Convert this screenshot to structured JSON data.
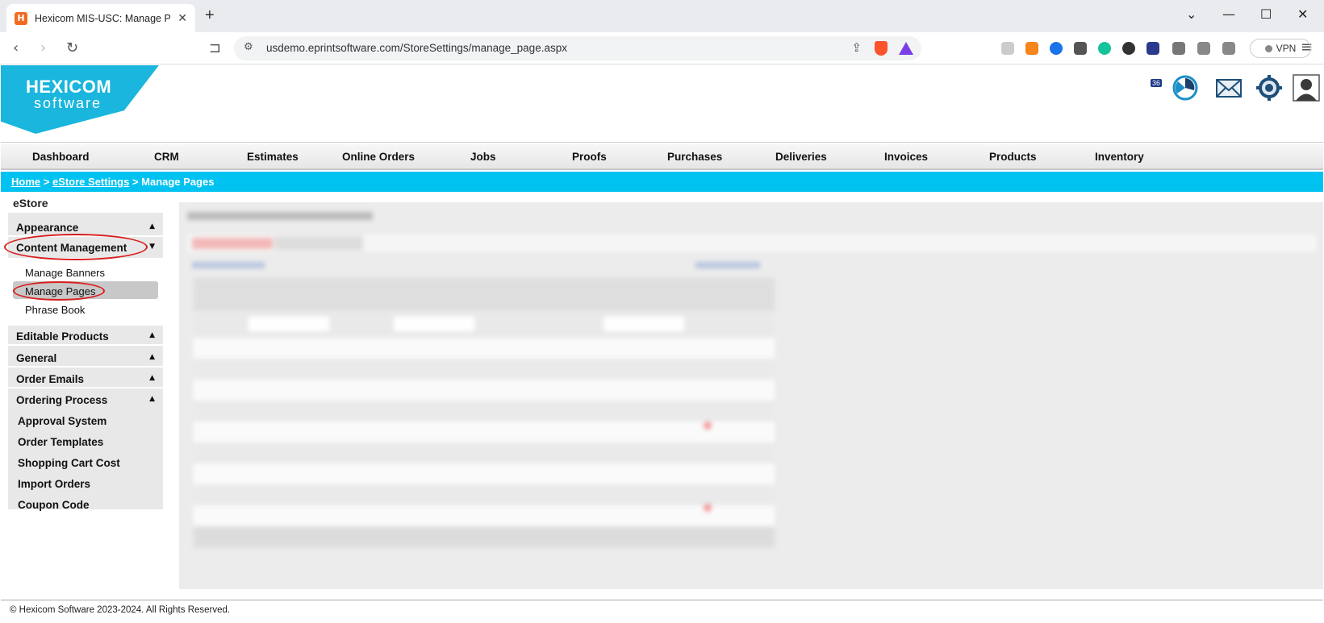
{
  "browser": {
    "tab_title": "Hexicom MIS-USC: Manage Pag",
    "tab_favicon": "H",
    "new_tab": "+",
    "url": "usdemo.eprintsoftware.com/StoreSettings/manage_page.aspx",
    "vpn_label": "VPN",
    "extension_badge": "36"
  },
  "header": {
    "logo_line1": "HEXICOM",
    "logo_line2": "software",
    "icons": [
      "chart-icon",
      "mail-icon",
      "settings-icon",
      "user-avatar-icon"
    ]
  },
  "nav": {
    "items": [
      "Dashboard",
      "CRM",
      "Estimates",
      "Online Orders",
      "Jobs",
      "Proofs",
      "Purchases",
      "Deliveries",
      "Invoices",
      "Products",
      "Inventory"
    ]
  },
  "breadcrumb": {
    "home": "Home",
    "sep1": " > ",
    "estore": "eStore Settings",
    "sep2": " > ",
    "current": "Manage Pages"
  },
  "sidebar": {
    "title": "eStore",
    "sections": [
      "Appearance",
      "Content Management",
      "Editable Products",
      "General",
      "Order Emails",
      "Ordering Process",
      "Approval System",
      "Order Templates",
      "Shopping Cart Cost",
      "Import Orders",
      "Coupon Code"
    ],
    "sub_items": [
      "Manage Banners",
      "Manage Pages",
      "Phrase Book"
    ]
  },
  "footer": {
    "text": "© Hexicom Software 2023-2024. All Rights Reserved."
  },
  "colors": {
    "accent": "#00c2f1",
    "logo": "#1ab6dd",
    "highlight": "#d81e1e"
  }
}
